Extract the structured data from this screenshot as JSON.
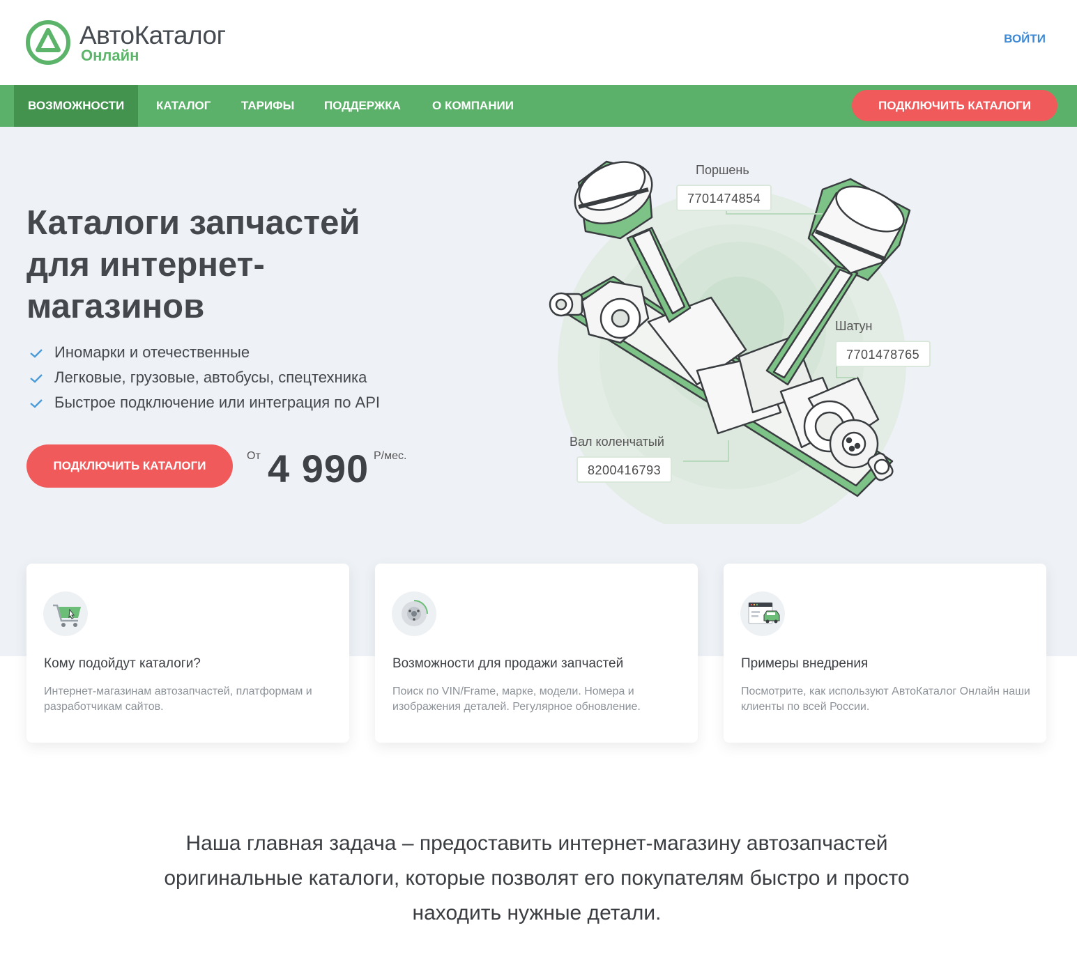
{
  "brand": {
    "name": "АвтоКаталог",
    "subtitle": "Онлайн",
    "accent_color": "#5cb16a",
    "cta_color": "#f05a5a",
    "link_color": "#3d8ad6"
  },
  "header": {
    "login_label": "ВОЙТИ"
  },
  "nav": {
    "items": [
      {
        "label": "ВОЗМОЖНОСТИ",
        "active": true
      },
      {
        "label": "КАТАЛОГ",
        "active": false
      },
      {
        "label": "ТАРИФЫ",
        "active": false
      },
      {
        "label": "ПОДДЕРЖКА",
        "active": false
      },
      {
        "label": "О КОМПАНИИ",
        "active": false
      }
    ],
    "cta_label": "ПОДКЛЮЧИТЬ КАТАЛОГИ"
  },
  "hero": {
    "title": "Каталоги запчастей для интернет-магазинов",
    "features": [
      "Иномарки и отечественные",
      "Легковые, грузовые, автобусы, спецтехника",
      "Быстрое подключение или интеграция по API"
    ],
    "cta_label": "ПОДКЛЮЧИТЬ КАТАЛОГИ",
    "price": {
      "prefix": "От",
      "value": "4 990",
      "unit": "Р/мес."
    },
    "parts": [
      {
        "name": "Поршень",
        "number": "7701474854"
      },
      {
        "name": "Шатун",
        "number": "7701478765"
      },
      {
        "name": "Вал коленчатый",
        "number": "8200416793"
      }
    ]
  },
  "cards": [
    {
      "icon": "shopping-cart-icon",
      "title": "Кому подойдут каталоги?",
      "description": "Интернет-магазинам автозапчастей, платформам и разработчикам сайтов."
    },
    {
      "icon": "brake-disc-icon",
      "title": "Возможности для продажи запчастей",
      "description": "Поиск по VIN/Frame, марке, модели. Номера и изображения деталей. Регулярное обновление."
    },
    {
      "icon": "browser-car-icon",
      "title": "Примеры внедрения",
      "description": "Посмотрите, как используют АвтоКаталог Онлайн наши клиенты по всей России."
    }
  ],
  "mission": "Наша главная задача – предоставить интернет-магазину автозапчастей оригинальные каталоги, которые позволят его покупателям быстро и просто находить нужные детали."
}
